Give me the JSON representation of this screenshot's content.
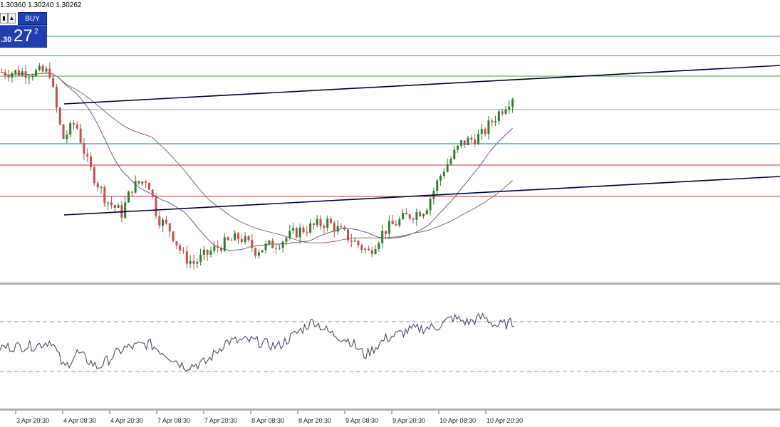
{
  "header": {
    "ohlc_values": [
      "1.30360",
      "1.30240",
      "1.30262"
    ]
  },
  "trade_panel": {
    "buy_label": "BUY",
    "price_small": ".30",
    "price_big": "27",
    "price_sup": "2",
    "color": "#1f3fb0"
  },
  "colors": {
    "bull_candle": "#2e7d32",
    "bear_candle": "#c0504d",
    "ma_fast": "#6a5a8c",
    "ma_slow": "#8a6a6a",
    "trendline": "#000033",
    "level_green": "#3aa63a",
    "level_teal": "#2a9a8a",
    "level_gray": "#9a9a9a",
    "level_blue": "#1f6fa0",
    "level_red": "#b03a2e",
    "oscillator": "#4a4a6a"
  },
  "chart_data": {
    "type": "candlestick",
    "title": "",
    "x_labels": [
      "3 Apr 20:30",
      "4 Apr 08:30",
      "4 Apr 20:30",
      "7 Apr 08:30",
      "7 Apr 20:30",
      "8 Apr 08:30",
      "8 Apr 20:30",
      "9 Apr 08:30",
      "9 Apr 20:30",
      "10 Apr 08:30",
      "10 Apr 20:30"
    ],
    "last_ohlc": {
      "high": 1.3036,
      "low": 1.3024,
      "close": 1.30262
    },
    "close_path": [
      {
        "t": 0,
        "v": 0.93
      },
      {
        "t": 0.1,
        "v": 0.93
      },
      {
        "t": 0.105,
        "v": 0.86
      },
      {
        "t": 0.125,
        "v": 0.62
      },
      {
        "t": 0.15,
        "v": 0.7
      },
      {
        "t": 0.175,
        "v": 0.5
      },
      {
        "t": 0.21,
        "v": 0.34
      },
      {
        "t": 0.24,
        "v": 0.28
      },
      {
        "t": 0.26,
        "v": 0.4
      },
      {
        "t": 0.29,
        "v": 0.44
      },
      {
        "t": 0.31,
        "v": 0.26
      },
      {
        "t": 0.335,
        "v": 0.2
      },
      {
        "t": 0.36,
        "v": 0.08
      },
      {
        "t": 0.38,
        "v": 0.05
      },
      {
        "t": 0.43,
        "v": 0.13
      },
      {
        "t": 0.47,
        "v": 0.17
      },
      {
        "t": 0.5,
        "v": 0.11
      },
      {
        "t": 0.54,
        "v": 0.14
      },
      {
        "t": 0.585,
        "v": 0.2
      },
      {
        "t": 0.64,
        "v": 0.24
      },
      {
        "t": 0.68,
        "v": 0.17
      },
      {
        "t": 0.72,
        "v": 0.1
      },
      {
        "t": 0.75,
        "v": 0.2
      },
      {
        "t": 0.79,
        "v": 0.26
      },
      {
        "t": 0.83,
        "v": 0.3
      },
      {
        "t": 0.865,
        "v": 0.48
      },
      {
        "t": 0.9,
        "v": 0.6
      },
      {
        "t": 0.94,
        "v": 0.64
      },
      {
        "t": 0.965,
        "v": 0.72
      },
      {
        "t": 1.0,
        "v": 0.82
      }
    ],
    "oscillator_path": [
      {
        "t": 0,
        "v": 0.48
      },
      {
        "t": 0.03,
        "v": 0.5
      },
      {
        "t": 0.07,
        "v": 0.52
      },
      {
        "t": 0.1,
        "v": 0.62
      },
      {
        "t": 0.125,
        "v": 0.06
      },
      {
        "t": 0.15,
        "v": 0.38
      },
      {
        "t": 0.19,
        "v": 0.08
      },
      {
        "t": 0.24,
        "v": 0.46
      },
      {
        "t": 0.29,
        "v": 0.56
      },
      {
        "t": 0.33,
        "v": 0.3
      },
      {
        "t": 0.36,
        "v": 0.1
      },
      {
        "t": 0.4,
        "v": 0.18
      },
      {
        "t": 0.44,
        "v": 0.6
      },
      {
        "t": 0.49,
        "v": 0.62
      },
      {
        "t": 0.54,
        "v": 0.5
      },
      {
        "t": 0.57,
        "v": 0.72
      },
      {
        "t": 0.61,
        "v": 1.02
      },
      {
        "t": 0.64,
        "v": 0.78
      },
      {
        "t": 0.68,
        "v": 0.62
      },
      {
        "t": 0.71,
        "v": 0.32
      },
      {
        "t": 0.75,
        "v": 0.66
      },
      {
        "t": 0.8,
        "v": 0.84
      },
      {
        "t": 0.85,
        "v": 0.9
      },
      {
        "t": 0.88,
        "v": 1.08
      },
      {
        "t": 0.91,
        "v": 0.98
      },
      {
        "t": 0.94,
        "v": 1.1
      },
      {
        "t": 0.965,
        "v": 0.92
      },
      {
        "t": 1.0,
        "v": 0.98
      }
    ],
    "oscillator_levels": [
      "upper",
      "lower"
    ],
    "horizontal_levels": [
      "green",
      "green",
      "green",
      "gray",
      "blue",
      "red",
      "red"
    ],
    "trendlines": 2,
    "moving_averages": 2,
    "grid": false,
    "legend": "none"
  }
}
